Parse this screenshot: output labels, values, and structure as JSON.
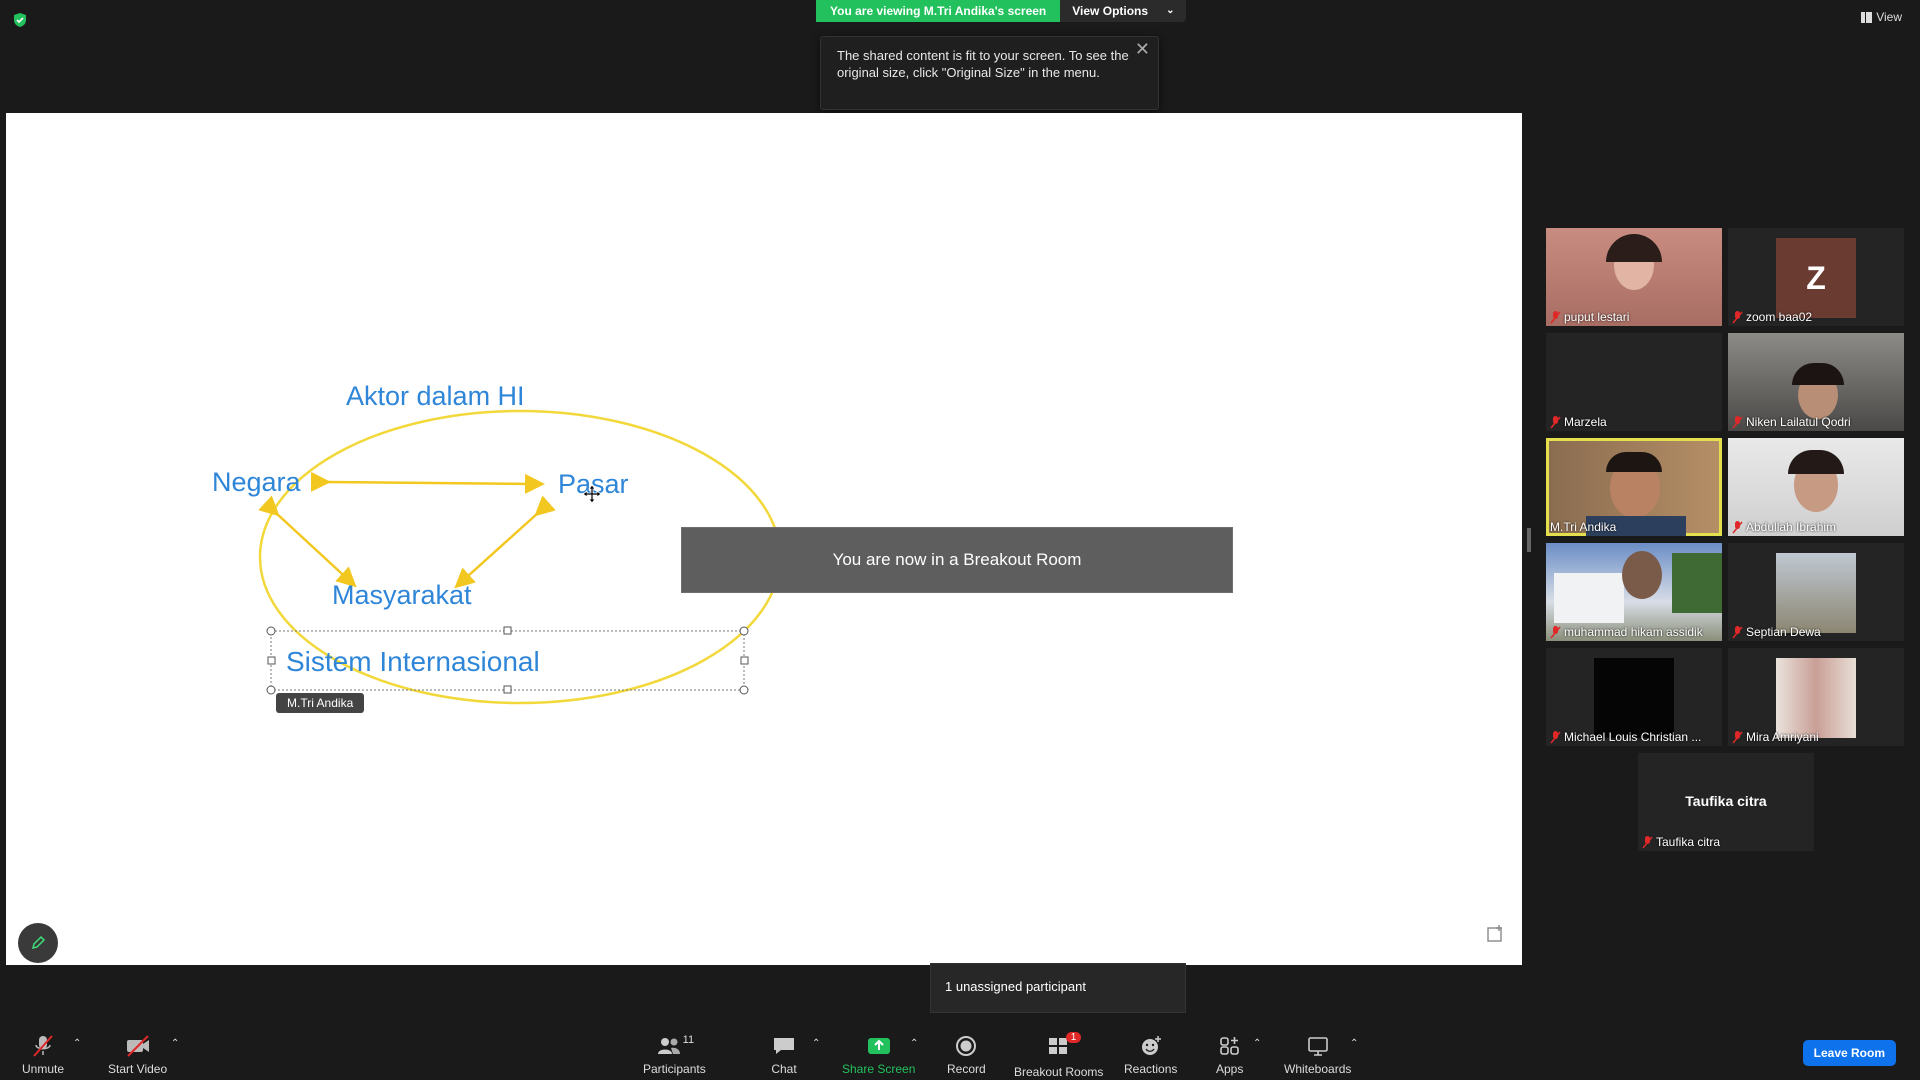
{
  "banner": {
    "viewing": "You are viewing M.Tri Andika's screen",
    "view_options": "View Options"
  },
  "top_right": {
    "view": "View"
  },
  "tooltip": {
    "text": "The shared content is fit to your screen. To see the original size, click \"Original Size\" in the menu."
  },
  "whiteboard": {
    "title": "Aktor dalam HI",
    "nodes": [
      "Negara",
      "Pasar",
      "Masyarakat"
    ],
    "selected_text": "Sistem Internasional",
    "author_tag": "M.Tri Andika",
    "colors": {
      "text": "#2f86d8",
      "ellipse": "#f2d83a",
      "arrows": "#f2c71f"
    }
  },
  "breakout_notice": "You are now in a Breakout Room",
  "participants": [
    {
      "name": "puput lestari",
      "muted": true
    },
    {
      "name": "zoom baa02",
      "muted": true,
      "avatar_letter": "Z"
    },
    {
      "name": "Marzela",
      "muted": true
    },
    {
      "name": "Niken Lailatul Qodri",
      "muted": true
    },
    {
      "name": "M.Tri Andika",
      "muted": false,
      "active_speaker": true
    },
    {
      "name": "Abdullah Ibrahim",
      "muted": true
    },
    {
      "name": "muhammad hikam assidik",
      "muted": true
    },
    {
      "name": "Septian Dewa",
      "muted": true
    },
    {
      "name": "Michael Louis Christian ...",
      "muted": true
    },
    {
      "name": "Mira Amriyani",
      "muted": true
    },
    {
      "name": "Taufika citra",
      "muted": true,
      "display_name": "Taufika citra"
    }
  ],
  "unassigned": "1 unassigned participant",
  "toolbar": {
    "unmute": "Unmute",
    "start_video": "Start Video",
    "participants": "Participants",
    "participants_count": "11",
    "chat": "Chat",
    "share_screen": "Share Screen",
    "record": "Record",
    "breakout_rooms": "Breakout Rooms",
    "breakout_badge": "1",
    "reactions": "Reactions",
    "apps": "Apps",
    "whiteboards": "Whiteboards",
    "leave_room": "Leave Room"
  },
  "icons": [
    "shield-icon",
    "mic-muted-icon",
    "video-off-icon",
    "participants-icon",
    "chat-icon",
    "share-screen-icon",
    "record-icon",
    "breakout-rooms-icon",
    "reactions-icon",
    "apps-icon",
    "whiteboards-icon",
    "pencil-icon",
    "close-icon"
  ]
}
